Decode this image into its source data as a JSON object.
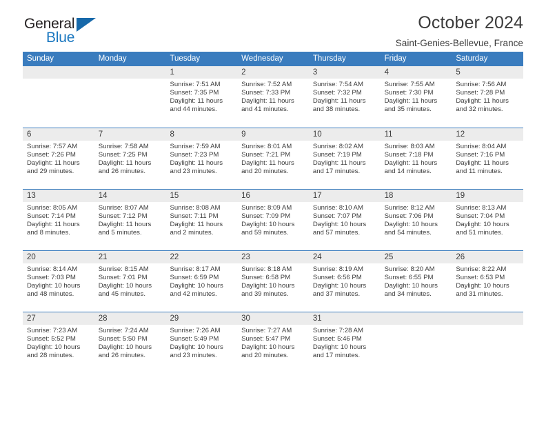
{
  "brand": {
    "name_part1": "General",
    "name_part2": "Blue",
    "triangle_icon": "triangle-icon",
    "accent_color": "#1c78c0"
  },
  "header": {
    "title": "October 2024",
    "subtitle": "Saint-Genies-Bellevue, France"
  },
  "theme": {
    "header_row_bg": "#3a7cbe",
    "day_band_bg": "#ececec",
    "text_color": "#3c3c3c",
    "row_divider": "#3a7cbe"
  },
  "calendar": {
    "weekday_headers": [
      "Sunday",
      "Monday",
      "Tuesday",
      "Wednesday",
      "Thursday",
      "Friday",
      "Saturday"
    ],
    "labels": {
      "sunrise": "Sunrise:",
      "sunset": "Sunset:",
      "daylight": "Daylight:"
    },
    "weeks": [
      [
        {
          "day": "",
          "empty": true,
          "sunrise": "",
          "sunset": "",
          "daylight": ""
        },
        {
          "day": "",
          "empty": true,
          "sunrise": "",
          "sunset": "",
          "daylight": ""
        },
        {
          "day": "1",
          "sunrise": "Sunrise: 7:51 AM",
          "sunset": "Sunset: 7:35 PM",
          "daylight": "Daylight: 11 hours and 44 minutes."
        },
        {
          "day": "2",
          "sunrise": "Sunrise: 7:52 AM",
          "sunset": "Sunset: 7:33 PM",
          "daylight": "Daylight: 11 hours and 41 minutes."
        },
        {
          "day": "3",
          "sunrise": "Sunrise: 7:54 AM",
          "sunset": "Sunset: 7:32 PM",
          "daylight": "Daylight: 11 hours and 38 minutes."
        },
        {
          "day": "4",
          "sunrise": "Sunrise: 7:55 AM",
          "sunset": "Sunset: 7:30 PM",
          "daylight": "Daylight: 11 hours and 35 minutes."
        },
        {
          "day": "5",
          "sunrise": "Sunrise: 7:56 AM",
          "sunset": "Sunset: 7:28 PM",
          "daylight": "Daylight: 11 hours and 32 minutes."
        }
      ],
      [
        {
          "day": "6",
          "sunrise": "Sunrise: 7:57 AM",
          "sunset": "Sunset: 7:26 PM",
          "daylight": "Daylight: 11 hours and 29 minutes."
        },
        {
          "day": "7",
          "sunrise": "Sunrise: 7:58 AM",
          "sunset": "Sunset: 7:25 PM",
          "daylight": "Daylight: 11 hours and 26 minutes."
        },
        {
          "day": "8",
          "sunrise": "Sunrise: 7:59 AM",
          "sunset": "Sunset: 7:23 PM",
          "daylight": "Daylight: 11 hours and 23 minutes."
        },
        {
          "day": "9",
          "sunrise": "Sunrise: 8:01 AM",
          "sunset": "Sunset: 7:21 PM",
          "daylight": "Daylight: 11 hours and 20 minutes."
        },
        {
          "day": "10",
          "sunrise": "Sunrise: 8:02 AM",
          "sunset": "Sunset: 7:19 PM",
          "daylight": "Daylight: 11 hours and 17 minutes."
        },
        {
          "day": "11",
          "sunrise": "Sunrise: 8:03 AM",
          "sunset": "Sunset: 7:18 PM",
          "daylight": "Daylight: 11 hours and 14 minutes."
        },
        {
          "day": "12",
          "sunrise": "Sunrise: 8:04 AM",
          "sunset": "Sunset: 7:16 PM",
          "daylight": "Daylight: 11 hours and 11 minutes."
        }
      ],
      [
        {
          "day": "13",
          "sunrise": "Sunrise: 8:05 AM",
          "sunset": "Sunset: 7:14 PM",
          "daylight": "Daylight: 11 hours and 8 minutes."
        },
        {
          "day": "14",
          "sunrise": "Sunrise: 8:07 AM",
          "sunset": "Sunset: 7:12 PM",
          "daylight": "Daylight: 11 hours and 5 minutes."
        },
        {
          "day": "15",
          "sunrise": "Sunrise: 8:08 AM",
          "sunset": "Sunset: 7:11 PM",
          "daylight": "Daylight: 11 hours and 2 minutes."
        },
        {
          "day": "16",
          "sunrise": "Sunrise: 8:09 AM",
          "sunset": "Sunset: 7:09 PM",
          "daylight": "Daylight: 10 hours and 59 minutes."
        },
        {
          "day": "17",
          "sunrise": "Sunrise: 8:10 AM",
          "sunset": "Sunset: 7:07 PM",
          "daylight": "Daylight: 10 hours and 57 minutes."
        },
        {
          "day": "18",
          "sunrise": "Sunrise: 8:12 AM",
          "sunset": "Sunset: 7:06 PM",
          "daylight": "Daylight: 10 hours and 54 minutes."
        },
        {
          "day": "19",
          "sunrise": "Sunrise: 8:13 AM",
          "sunset": "Sunset: 7:04 PM",
          "daylight": "Daylight: 10 hours and 51 minutes."
        }
      ],
      [
        {
          "day": "20",
          "sunrise": "Sunrise: 8:14 AM",
          "sunset": "Sunset: 7:03 PM",
          "daylight": "Daylight: 10 hours and 48 minutes."
        },
        {
          "day": "21",
          "sunrise": "Sunrise: 8:15 AM",
          "sunset": "Sunset: 7:01 PM",
          "daylight": "Daylight: 10 hours and 45 minutes."
        },
        {
          "day": "22",
          "sunrise": "Sunrise: 8:17 AM",
          "sunset": "Sunset: 6:59 PM",
          "daylight": "Daylight: 10 hours and 42 minutes."
        },
        {
          "day": "23",
          "sunrise": "Sunrise: 8:18 AM",
          "sunset": "Sunset: 6:58 PM",
          "daylight": "Daylight: 10 hours and 39 minutes."
        },
        {
          "day": "24",
          "sunrise": "Sunrise: 8:19 AM",
          "sunset": "Sunset: 6:56 PM",
          "daylight": "Daylight: 10 hours and 37 minutes."
        },
        {
          "day": "25",
          "sunrise": "Sunrise: 8:20 AM",
          "sunset": "Sunset: 6:55 PM",
          "daylight": "Daylight: 10 hours and 34 minutes."
        },
        {
          "day": "26",
          "sunrise": "Sunrise: 8:22 AM",
          "sunset": "Sunset: 6:53 PM",
          "daylight": "Daylight: 10 hours and 31 minutes."
        }
      ],
      [
        {
          "day": "27",
          "sunrise": "Sunrise: 7:23 AM",
          "sunset": "Sunset: 5:52 PM",
          "daylight": "Daylight: 10 hours and 28 minutes."
        },
        {
          "day": "28",
          "sunrise": "Sunrise: 7:24 AM",
          "sunset": "Sunset: 5:50 PM",
          "daylight": "Daylight: 10 hours and 26 minutes."
        },
        {
          "day": "29",
          "sunrise": "Sunrise: 7:26 AM",
          "sunset": "Sunset: 5:49 PM",
          "daylight": "Daylight: 10 hours and 23 minutes."
        },
        {
          "day": "30",
          "sunrise": "Sunrise: 7:27 AM",
          "sunset": "Sunset: 5:47 PM",
          "daylight": "Daylight: 10 hours and 20 minutes."
        },
        {
          "day": "31",
          "sunrise": "Sunrise: 7:28 AM",
          "sunset": "Sunset: 5:46 PM",
          "daylight": "Daylight: 10 hours and 17 minutes."
        },
        {
          "day": "",
          "empty": true,
          "sunrise": "",
          "sunset": "",
          "daylight": ""
        },
        {
          "day": "",
          "empty": true,
          "sunrise": "",
          "sunset": "",
          "daylight": ""
        }
      ]
    ]
  }
}
